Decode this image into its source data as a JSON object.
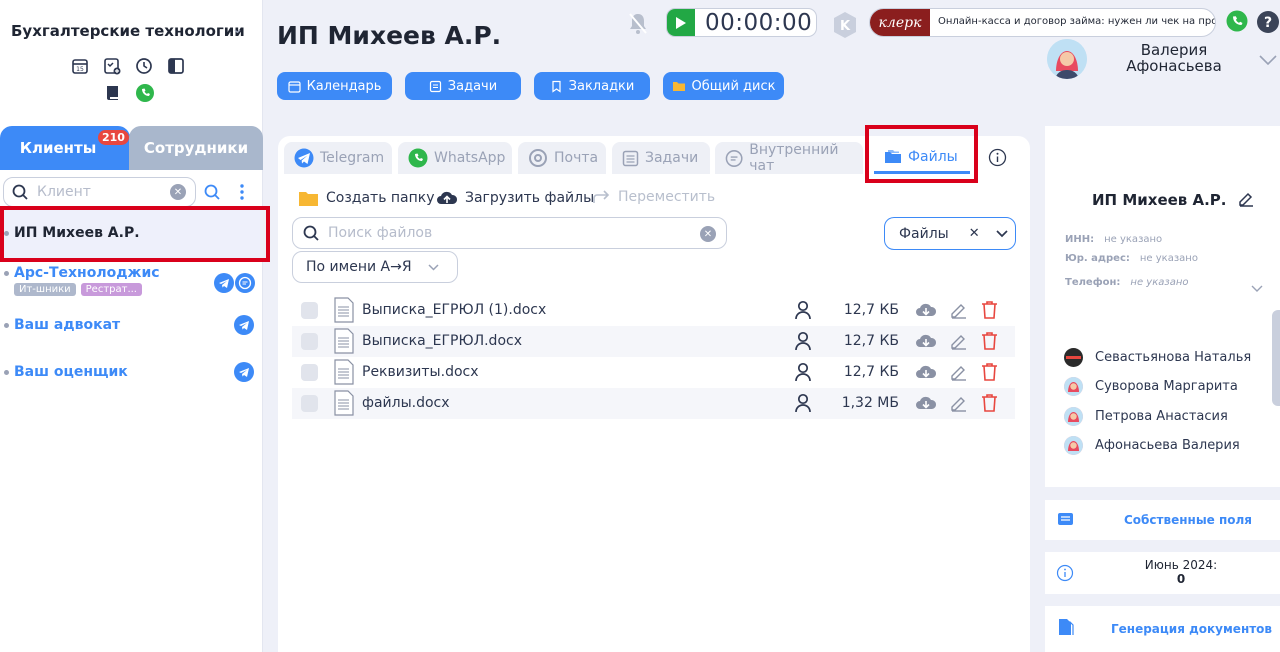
{
  "sidebar": {
    "company": "Бухгалтерские технологии",
    "tabs": {
      "clients": "Клиенты",
      "clients_count": "210",
      "staff": "Сотрудники"
    },
    "search_placeholder": "Клиент",
    "clients": [
      {
        "name": "ИП Михеев А.Р.",
        "tags": []
      },
      {
        "name": "Арс-Технолоджис",
        "tags": [
          {
            "label": "Ит-шники",
            "color": "#aeb8cc"
          },
          {
            "label": "Рестрат...",
            "color": "#c89adb"
          }
        ]
      },
      {
        "name": "Ваш адвокат",
        "tags": []
      },
      {
        "name": "Ваш оценщик",
        "tags": []
      }
    ]
  },
  "header": {
    "title": "ИП Михеев А.Р.",
    "buttons": {
      "calendar": "Календарь",
      "tasks": "Задачи",
      "bookmarks": "Закладки",
      "shared_disk": "Общий диск"
    },
    "timer": "00:00:00",
    "klerk": {
      "logo": "клерк",
      "text": "Онлайн-касса и договор займа: нужен ли чек на проценты"
    },
    "user": {
      "first": "Валерия",
      "last": "Афонасьева"
    }
  },
  "main": {
    "tabs": {
      "telegram": "Telegram",
      "whatsapp": "WhatsApp",
      "mail": "Почта",
      "tasks": "Задачи",
      "internal_chat": "Внутренний чат",
      "files": "Файлы"
    },
    "actions": {
      "create_folder": "Создать папку",
      "upload": "Загрузить файлы",
      "move": "Переместить"
    },
    "search_placeholder": "Поиск файлов",
    "filter": "Файлы",
    "sort": "По имени А→Я",
    "files": [
      {
        "name": "Выписка_ЕГРЮЛ (1).docx",
        "size": "12,7 КБ"
      },
      {
        "name": "Выписка_ЕГРЮЛ.docx",
        "size": "12,7 КБ"
      },
      {
        "name": "Реквизиты.docx",
        "size": "12,7 КБ"
      },
      {
        "name": "файлы.docx",
        "size": "1,32 МБ"
      }
    ]
  },
  "client_card": {
    "title": "ИП Михеев А.Р.",
    "inn_label": "ИНН:",
    "inn_value": "не указано",
    "address_label": "Юр. адрес:",
    "address_value": "не указано",
    "phone_label": "Телефон:",
    "phone_value": "не указано",
    "people": [
      "Севастьянова Наталья",
      "Суворова Маргарита",
      "Петрова Анастасия",
      "Афонасьева Валерия"
    ],
    "custom_fields": "Собственные поля",
    "period": "Июнь 2024:",
    "period_value": "0",
    "generate_docs": "Генерация документов"
  },
  "colors": {
    "accent": "#3d8af7",
    "highlight": "#d9001b",
    "timer_play": "#22a845",
    "delete": "#e8473f"
  }
}
